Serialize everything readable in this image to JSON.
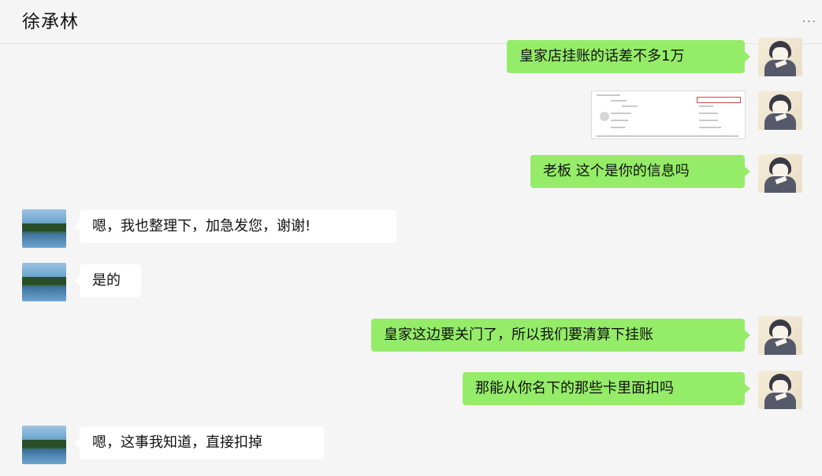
{
  "header": {
    "contact_name": "徐承林",
    "more_label": "···"
  },
  "messages": [
    {
      "side": "self",
      "type": "text",
      "text": "皇家店挂账的话差不多1万"
    },
    {
      "side": "self",
      "type": "image",
      "alt": "screenshot-thumbnail"
    },
    {
      "side": "self",
      "type": "text",
      "text": "老板 这个是你的信息吗"
    },
    {
      "side": "other",
      "type": "text",
      "text": "嗯，我也整理下，加急发您，谢谢!"
    },
    {
      "side": "other",
      "type": "text",
      "text": "是的"
    },
    {
      "side": "self",
      "type": "text",
      "text": "皇家这边要关门了，所以我们要清算下挂账"
    },
    {
      "side": "self",
      "type": "text",
      "text": "那能从你名下的那些卡里面扣吗"
    },
    {
      "side": "other",
      "type": "text",
      "text": "嗯，这事我知道，直接扣掉"
    }
  ],
  "colors": {
    "background": "#f5f5f5",
    "self_bubble": "#95ec69",
    "other_bubble": "#ffffff"
  }
}
